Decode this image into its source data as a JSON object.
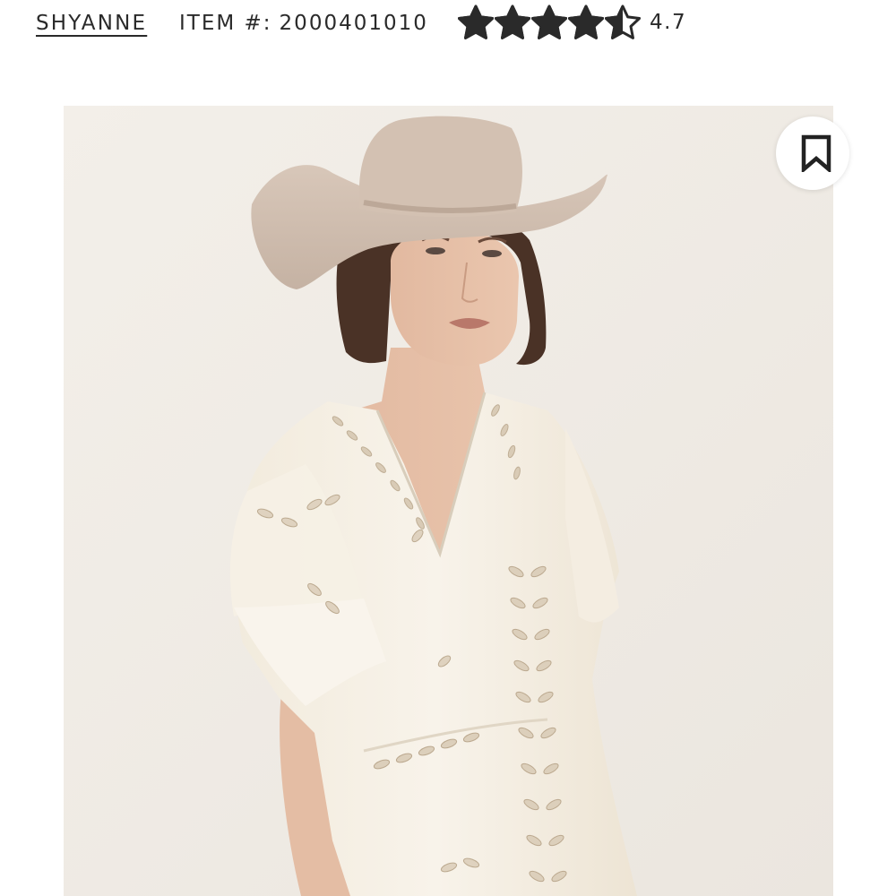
{
  "header": {
    "brand": "SHYANNE",
    "item_label": "ITEM #:",
    "item_number": "2000401010",
    "rating": {
      "value": "4.7",
      "stars_total": 5,
      "stars_filled": 4.7
    }
  },
  "product": {
    "bookmark_icon": "bookmark-icon"
  },
  "colors": {
    "text": "#2a2a2a",
    "photo_background": "#f1ede7",
    "star": "#2a2a2a"
  }
}
